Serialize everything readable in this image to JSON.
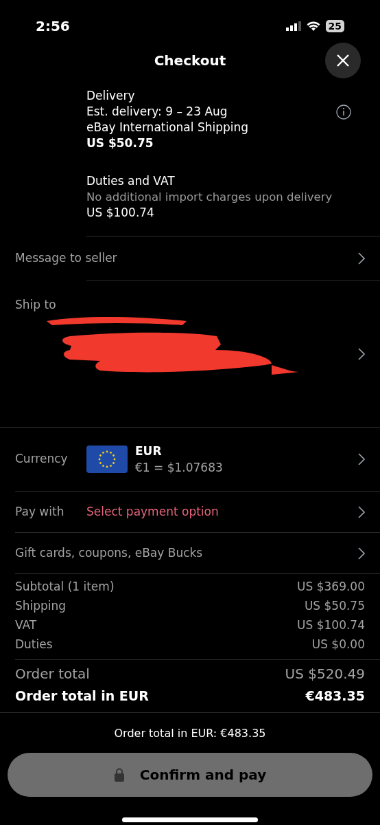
{
  "status_bar": {
    "time": "2:56",
    "battery": "25"
  },
  "header": {
    "title": "Checkout"
  },
  "delivery": {
    "heading": "Delivery",
    "estimate": "Est. delivery: 9 – 23 Aug",
    "service": "eBay International Shipping",
    "price": "US $50.75"
  },
  "duties": {
    "heading": "Duties and VAT",
    "note": "No additional import charges upon delivery",
    "price": "US $100.74"
  },
  "message_row": {
    "label": "Message to seller"
  },
  "ship_to": {
    "label": "Ship to"
  },
  "currency": {
    "label": "Currency",
    "code": "EUR",
    "rate": "€1 = $1.07683"
  },
  "pay_with": {
    "label": "Pay with",
    "value": "Select payment option"
  },
  "gift_row": {
    "label": "Gift cards, coupons, eBay Bucks"
  },
  "summary": [
    {
      "label": "Subtotal (1 item)",
      "value": "US $369.00"
    },
    {
      "label": "Shipping",
      "value": "US $50.75"
    },
    {
      "label": "VAT",
      "value": "US $100.74"
    },
    {
      "label": "Duties",
      "value": "US $0.00"
    }
  ],
  "totals": [
    {
      "kind": "total",
      "label": "Order total",
      "value": "US $520.49"
    },
    {
      "kind": "grand",
      "label": "Order total in EUR",
      "value": "€483.35"
    }
  ],
  "footer": {
    "note": "Order total in EUR: €483.35",
    "button": {
      "label": "Confirm and pay",
      "disabled": true
    }
  }
}
